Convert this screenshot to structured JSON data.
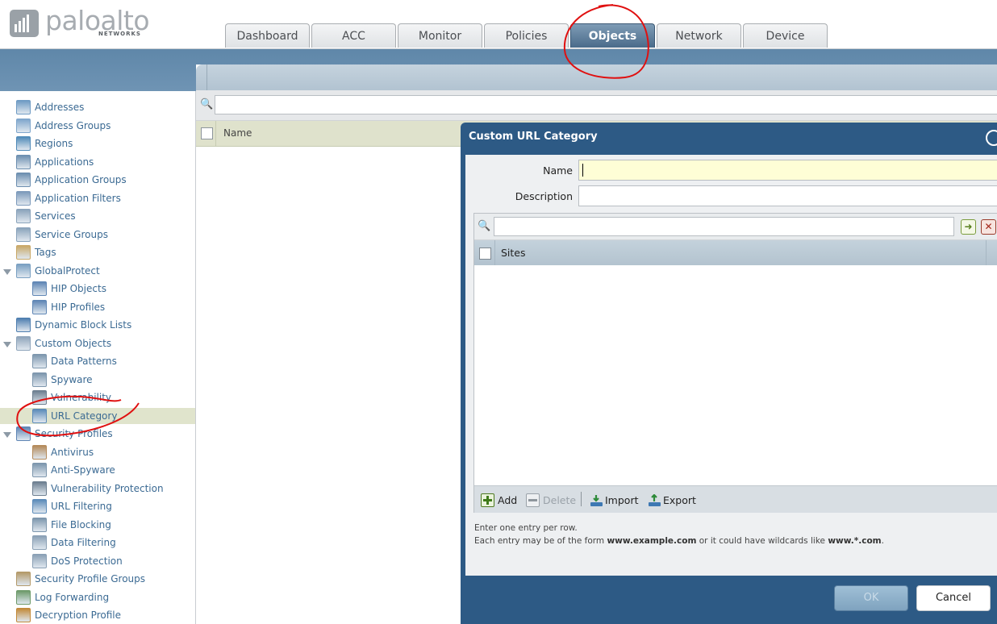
{
  "brand": {
    "logo_name": "paloalto",
    "logo_sub": "NETWORKS"
  },
  "tabs": [
    {
      "label": "Dashboard",
      "active": false
    },
    {
      "label": "ACC",
      "active": false
    },
    {
      "label": "Monitor",
      "active": false
    },
    {
      "label": "Policies",
      "active": false
    },
    {
      "label": "Objects",
      "active": true
    },
    {
      "label": "Network",
      "active": false
    },
    {
      "label": "Device",
      "active": false
    }
  ],
  "sidebar": {
    "items": [
      {
        "label": "Addresses",
        "icon": "address-icon"
      },
      {
        "label": "Address Groups",
        "icon": "address-group-icon"
      },
      {
        "label": "Regions",
        "icon": "globe-icon"
      },
      {
        "label": "Applications",
        "icon": "application-icon"
      },
      {
        "label": "Application Groups",
        "icon": "application-group-icon"
      },
      {
        "label": "Application Filters",
        "icon": "filter-icon"
      },
      {
        "label": "Services",
        "icon": "tools-icon"
      },
      {
        "label": "Service Groups",
        "icon": "tools-group-icon"
      },
      {
        "label": "Tags",
        "icon": "tag-icon"
      },
      {
        "label": "GlobalProtect",
        "icon": "globalprotect-icon",
        "expandable": true
      },
      {
        "label": "HIP Objects",
        "icon": "hip-object-icon",
        "child": true
      },
      {
        "label": "HIP Profiles",
        "icon": "hip-profile-icon",
        "child": true
      },
      {
        "label": "Dynamic Block Lists",
        "icon": "block-list-icon"
      },
      {
        "label": "Custom Objects",
        "icon": "custom-objects-icon",
        "expandable": true
      },
      {
        "label": "Data Patterns",
        "icon": "data-pattern-icon",
        "child": true
      },
      {
        "label": "Spyware",
        "icon": "spyware-icon",
        "child": true
      },
      {
        "label": "Vulnerability",
        "icon": "vulnerability-icon",
        "child": true
      },
      {
        "label": "URL Category",
        "icon": "url-category-icon",
        "child": true,
        "selected": true
      },
      {
        "label": "Security Profiles",
        "icon": "security-profiles-icon",
        "expandable": true
      },
      {
        "label": "Antivirus",
        "icon": "antivirus-icon",
        "child": true
      },
      {
        "label": "Anti-Spyware",
        "icon": "anti-spyware-icon",
        "child": true
      },
      {
        "label": "Vulnerability Protection",
        "icon": "vulnerability-protection-icon",
        "child": true
      },
      {
        "label": "URL Filtering",
        "icon": "url-filtering-icon",
        "child": true
      },
      {
        "label": "File Blocking",
        "icon": "file-blocking-icon",
        "child": true
      },
      {
        "label": "Data Filtering",
        "icon": "data-filtering-icon",
        "child": true
      },
      {
        "label": "DoS Protection",
        "icon": "dos-protection-icon",
        "child": true
      },
      {
        "label": "Security Profile Groups",
        "icon": "profile-groups-icon"
      },
      {
        "label": "Log Forwarding",
        "icon": "log-forwarding-icon"
      },
      {
        "label": "Decryption Profile",
        "icon": "decryption-icon"
      }
    ]
  },
  "main": {
    "grid_columns": [
      "Name"
    ]
  },
  "dialog": {
    "title": "Custom URL Category",
    "name_label": "Name",
    "name_value": "",
    "description_label": "Description",
    "description_value": "",
    "sites_filter_value": "",
    "sites_column": "Sites",
    "toolbar": {
      "add": "Add",
      "delete": "Delete",
      "import": "Import",
      "export": "Export"
    },
    "help_line1": "Enter one entry per row.",
    "help_line2_a": "Each entry may be of the form ",
    "help_example1": "www.example.com",
    "help_line2_b": " or it could have wildcards like ",
    "help_example2": "www.*.com",
    "help_line2_c": ".",
    "ok_label": "OK",
    "cancel_label": "Cancel"
  },
  "colors": {
    "accent_blue": "#2d5a85",
    "band_blue": "#6a90b0",
    "link_blue": "#3b6a93",
    "annotation_red": "#e01010",
    "name_field_bg": "#fefed6"
  }
}
